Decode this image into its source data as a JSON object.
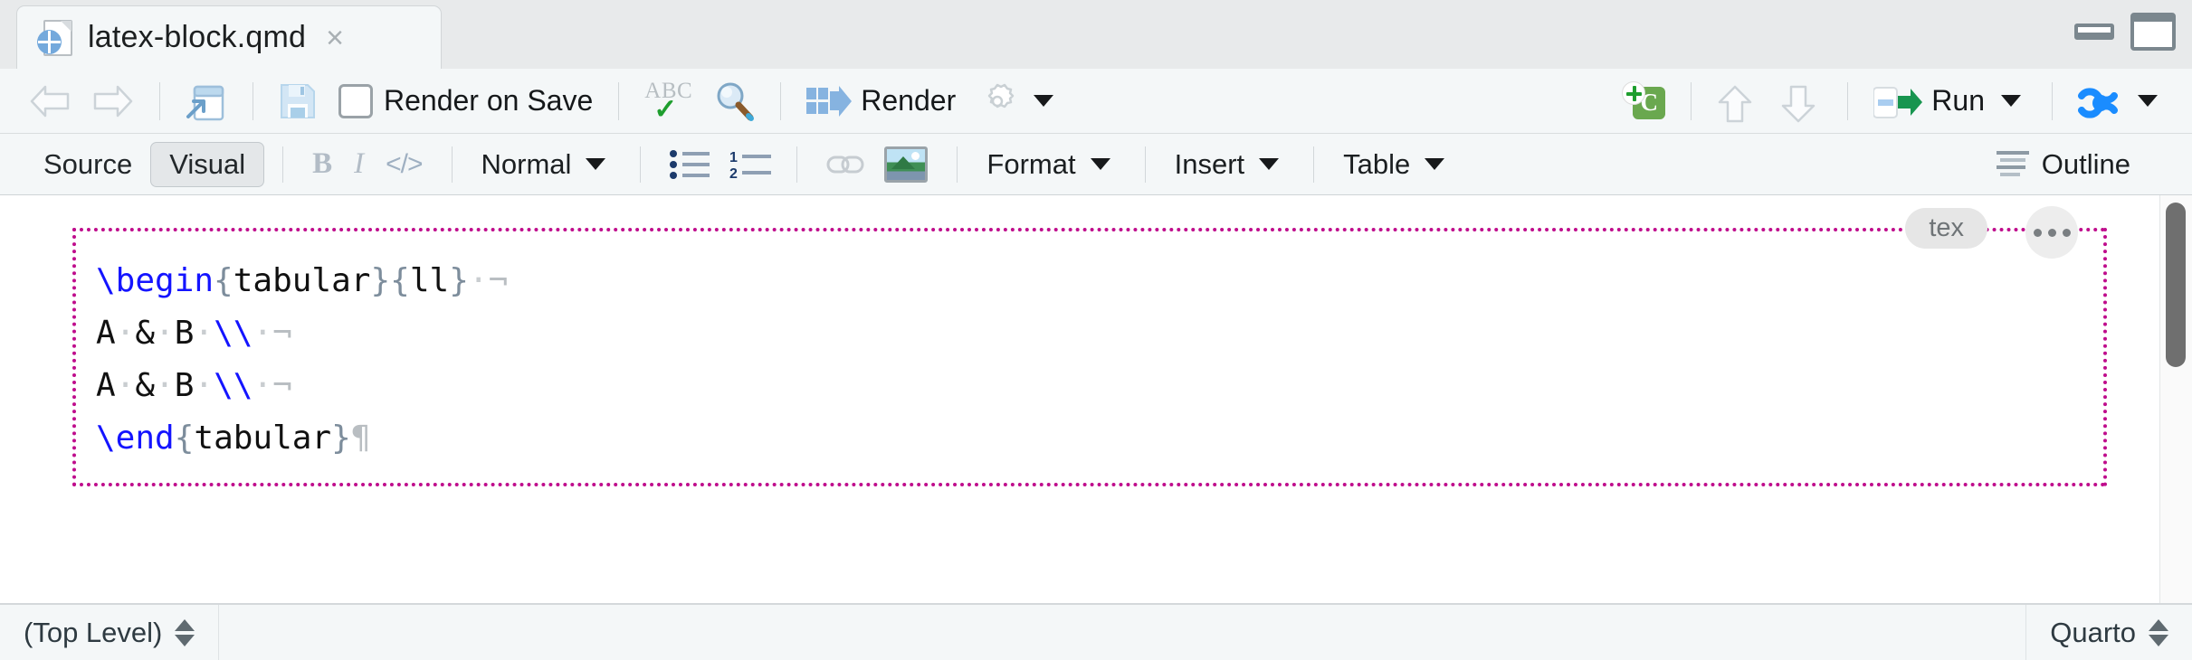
{
  "window": {
    "tab_title": "latex-block.qmd",
    "tab_close_label": "×",
    "minimize_name": "minimize-button",
    "maximize_name": "maximize-button"
  },
  "toolbar": {
    "back_label": "",
    "forward_label": "",
    "show_in_new_window_label": "",
    "save_label": "",
    "render_on_save_label": "Render on Save",
    "spellcheck_label": "",
    "find_label": "",
    "render_label": "Render",
    "settings_label": "",
    "settings_caret": "",
    "insert_chunk_label": "C",
    "move_up_label": "",
    "move_down_label": "",
    "run_label": "Run",
    "run_caret": "",
    "publish_label": "",
    "publish_caret": ""
  },
  "visual_toolbar": {
    "source_label": "Source",
    "visual_label": "Visual",
    "bold_label": "B",
    "italic_label": "I",
    "code_label": "</>",
    "block_format_label": "Normal",
    "bullet_list_label": "",
    "numbered_list_label": "",
    "link_label": "",
    "image_label": "",
    "format_label": "Format",
    "insert_label": "Insert",
    "table_label": "Table",
    "outline_label": "Outline"
  },
  "editor": {
    "block_badge": "tex",
    "block_menu_label": "•••",
    "lines": [
      {
        "segments": [
          {
            "text": "\\begin",
            "style": "kw"
          },
          {
            "text": "{",
            "style": "brace"
          },
          {
            "text": "tabular",
            "style": "plain"
          },
          {
            "text": "}",
            "style": "brace"
          },
          {
            "text": "{",
            "style": "brace"
          },
          {
            "text": "ll",
            "style": "plain"
          },
          {
            "text": "}",
            "style": "brace"
          },
          {
            "text": "·",
            "style": "dot"
          },
          {
            "text": "¬",
            "style": "mark"
          }
        ]
      },
      {
        "segments": [
          {
            "text": "A",
            "style": "plain"
          },
          {
            "text": "·",
            "style": "dot"
          },
          {
            "text": "&",
            "style": "plain"
          },
          {
            "text": "·",
            "style": "dot"
          },
          {
            "text": "B",
            "style": "plain"
          },
          {
            "text": "·",
            "style": "dot"
          },
          {
            "text": "\\\\",
            "style": "kw"
          },
          {
            "text": "·",
            "style": "dot"
          },
          {
            "text": "¬",
            "style": "mark"
          }
        ]
      },
      {
        "segments": [
          {
            "text": "A",
            "style": "plain"
          },
          {
            "text": "·",
            "style": "dot"
          },
          {
            "text": "&",
            "style": "plain"
          },
          {
            "text": "·",
            "style": "dot"
          },
          {
            "text": "B",
            "style": "plain"
          },
          {
            "text": "·",
            "style": "dot"
          },
          {
            "text": "\\\\",
            "style": "kw"
          },
          {
            "text": "·",
            "style": "dot"
          },
          {
            "text": "¬",
            "style": "mark"
          }
        ]
      },
      {
        "segments": [
          {
            "text": "\\end",
            "style": "kw"
          },
          {
            "text": "{",
            "style": "brace"
          },
          {
            "text": "tabular",
            "style": "plain"
          },
          {
            "text": "}",
            "style": "brace"
          },
          {
            "text": "¶",
            "style": "pil"
          }
        ]
      }
    ]
  },
  "statusbar": {
    "scope_label": "(Top Level)",
    "doctype_label": "Quarto"
  },
  "colors": {
    "block_border": "#bf0d8c",
    "latex_keyword": "#1414ff",
    "latex_brace": "#7d8d9c",
    "accent_green": "#1e9e2e",
    "accent_blue": "#1a8cff",
    "chunk_green": "#6aa84f",
    "toolbar_bg": "#f4f7f8",
    "tabbar_bg": "#e8eaeb"
  }
}
